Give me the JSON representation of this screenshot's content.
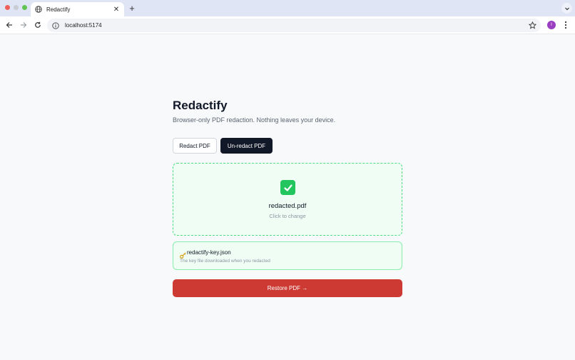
{
  "browser": {
    "tab_title": "Redactify",
    "tab_close": "✕",
    "new_tab": "+",
    "url": "localhost:5174",
    "avatar_letter": "I"
  },
  "app": {
    "title": "Redactify",
    "subtitle": "Browser-only PDF redaction. Nothing leaves your device.",
    "modes": {
      "redact_label": "Redact PDF",
      "unredact_label": "Un-redact PDF",
      "active": "unredact"
    },
    "dropzone": {
      "icon": "check-mark-icon",
      "file_name": "redacted.pdf",
      "hint": "Click to change"
    },
    "key_file": {
      "icon": "key-icon",
      "name": "redactify-key.json",
      "description": "The key file downloaded when you redacted"
    },
    "restore_label": "Restore PDF →"
  },
  "colors": {
    "primary_dark": "#111827",
    "success_bg": "#f0fdf4",
    "success_border": "#4ade80",
    "danger": "#cc3a33"
  }
}
